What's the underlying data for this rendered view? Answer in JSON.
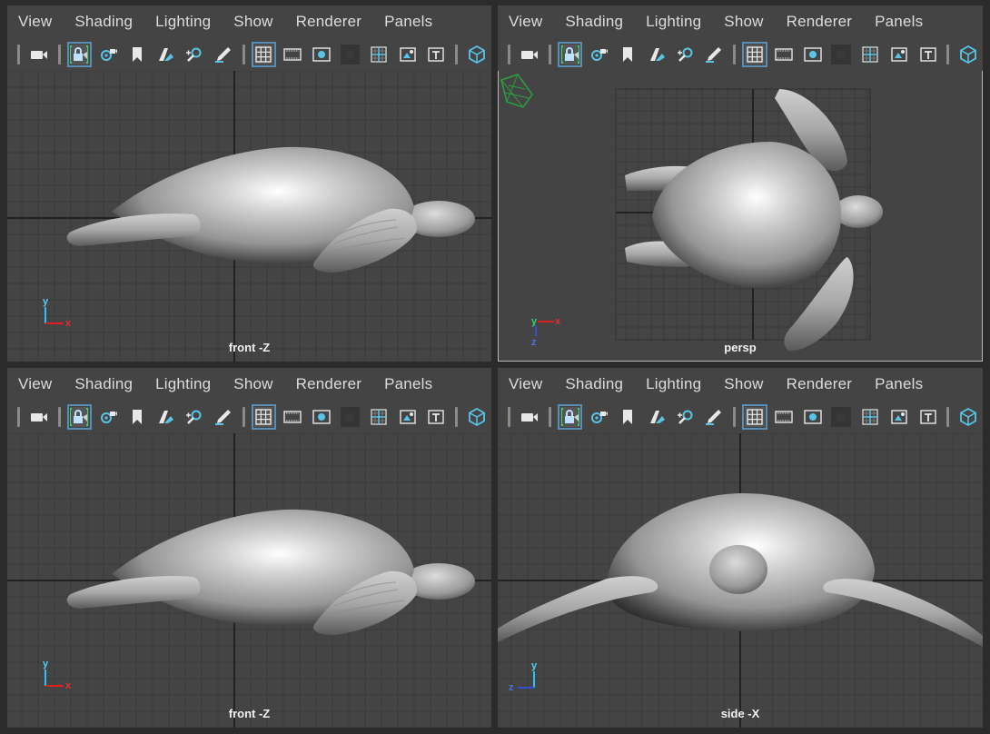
{
  "menu": [
    "View",
    "Shading",
    "Lighting",
    "Show",
    "Renderer",
    "Panels"
  ],
  "panels": [
    {
      "label": "front -Z",
      "axis": [
        "y",
        "x"
      ],
      "active": false
    },
    {
      "label": "persp",
      "axis": [
        "y",
        "x",
        "z"
      ],
      "active": true
    },
    {
      "label": "front -Z",
      "axis": [
        "y",
        "x"
      ],
      "active": false
    },
    {
      "label": "side -X",
      "axis": [
        "y",
        "z"
      ],
      "active": false
    }
  ],
  "toolbar_icons": [
    "camera-icon",
    "lock-camera-icon",
    "camera-attributes-icon",
    "bookmark-icon",
    "image-plane-icon",
    "2d-pan-zoom-icon",
    "grease-pencil-icon",
    "grid-icon",
    "film-gate-icon",
    "resolution-gate-icon",
    "gate-mask-icon",
    "field-chart-icon",
    "safe-action-icon",
    "safe-title-icon",
    "isolate-select-icon"
  ],
  "colors": {
    "bg": "#444444",
    "grid": "#3a3a3a",
    "grid_axis": "#232323",
    "accent": "#5a8db5",
    "axis_y": "#3fc0ff",
    "axis_x": "#e02020",
    "axis_z": "#3050d0"
  }
}
